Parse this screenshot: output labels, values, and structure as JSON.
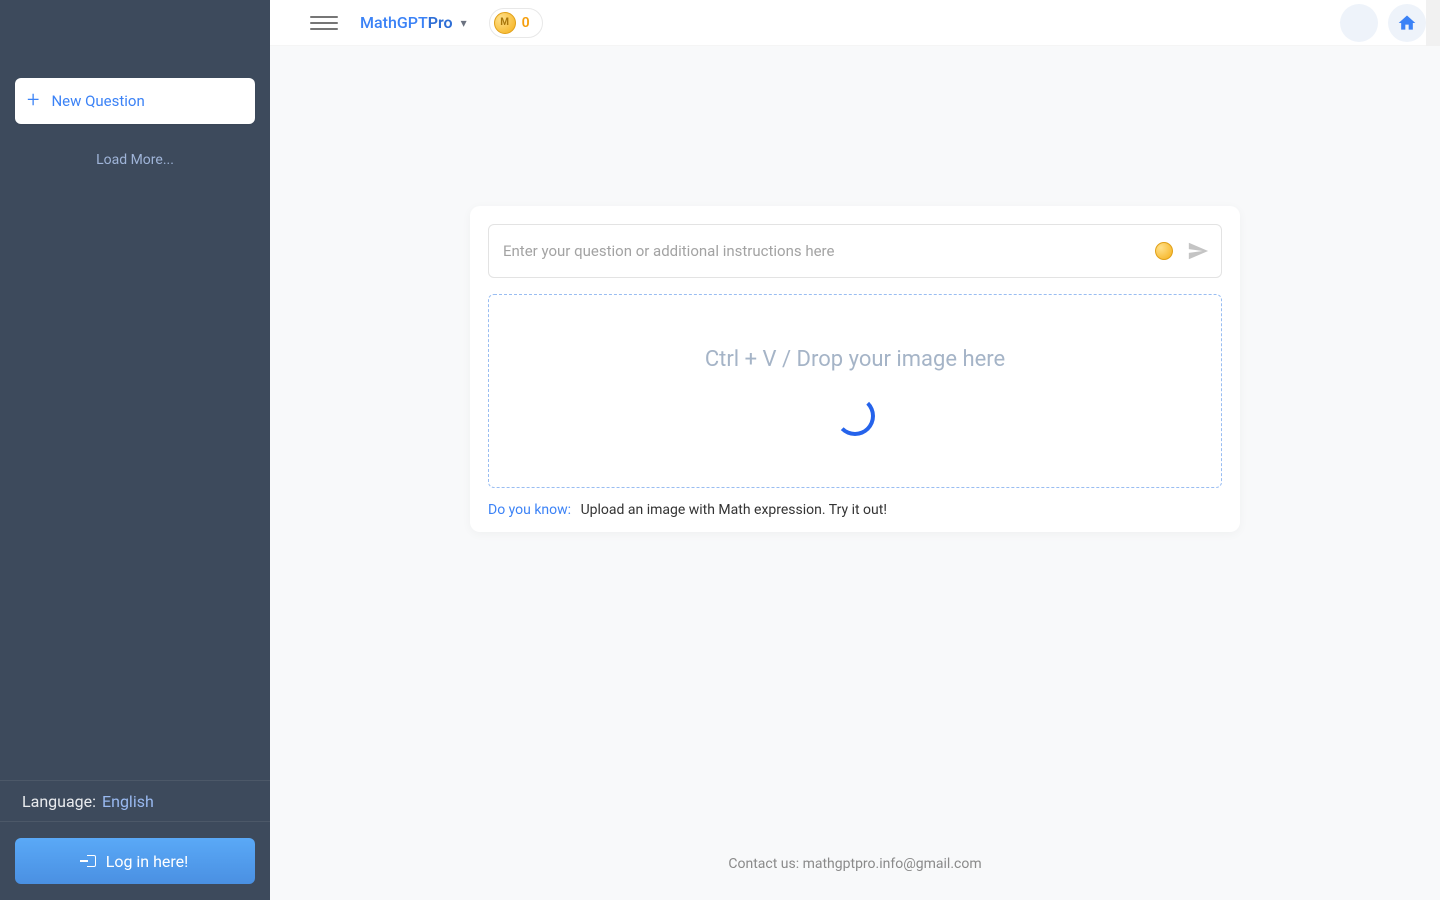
{
  "brand": {
    "part1": "Math",
    "part2": "GPT",
    "part3": "Pro"
  },
  "sidebar": {
    "new_question_label": "New Question",
    "load_more_label": "Load More...",
    "language_label": "Language:",
    "language_value": "English",
    "login_label": "Log in here!"
  },
  "topbar": {
    "coin_letter": "M",
    "coin_count": "0"
  },
  "main": {
    "input_placeholder": "Enter your question or additional instructions here",
    "dropzone_text": "Ctrl + V / Drop your image here",
    "hint_label": "Do you know:",
    "hint_text": "Upload an image with Math expression. Try it out!",
    "contact_text": "Contact us: mathgptpro.info@gmail.com"
  },
  "icons": {
    "plus": "plus-icon",
    "hamburger": "hamburger-icon",
    "caret_down": "caret-down-icon",
    "coin": "coin-icon",
    "home": "home-icon",
    "send": "send-icon",
    "login": "login-icon",
    "avatar": "avatar-icon"
  },
  "colors": {
    "sidebar_bg": "#3d4a5c",
    "accent_blue": "#3b82f6",
    "coin_gold": "#f5b01a"
  }
}
